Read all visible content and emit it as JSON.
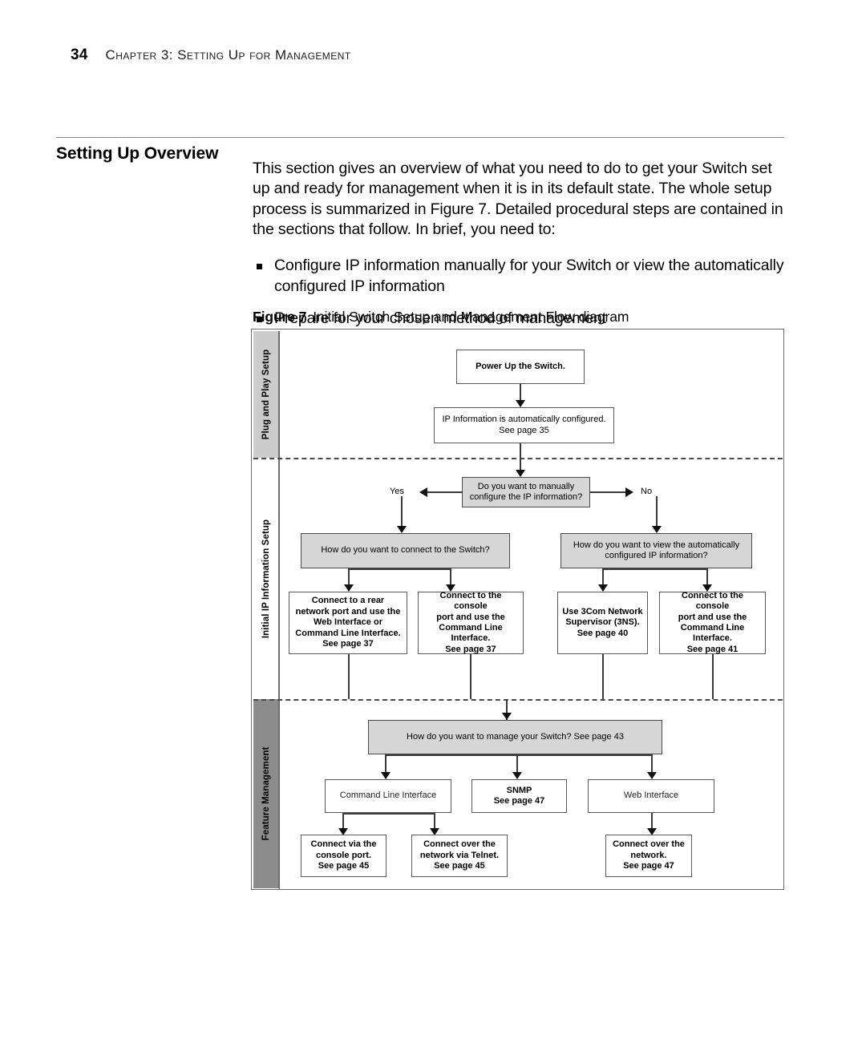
{
  "header": {
    "folio": "34",
    "chapter": "Chapter 3: Setting Up for Management"
  },
  "section": {
    "heading": "Setting Up Overview",
    "intro": "This section gives an overview of what you need to do to get your Switch set up and ready for management when it is in its default state. The whole setup process is summarized in Figure 7. Detailed procedural steps are contained in the sections that follow. In brief, you need to:",
    "bullets": [
      "Configure IP information manually for your Switch or view the automatically configured IP information",
      "Prepare for your chosen method of management"
    ]
  },
  "figure": {
    "label": "Figure 7",
    "caption": "Initial Switch Setup and Management Flow diagram",
    "bands": [
      {
        "id": "plug-and-play-setup",
        "label": "Plug and Play Setup",
        "fill": "#cccccc"
      },
      {
        "id": "initial-ip-information-setup",
        "label": "Initial IP Information Setup",
        "fill": "#ffffff"
      },
      {
        "id": "feature-management",
        "label": "Feature Management",
        "fill": "#8c8c8c"
      }
    ],
    "branch_labels": {
      "yes": "Yes",
      "no": "No"
    },
    "nodes": {
      "power_up": "Power Up the Switch.",
      "ip_auto": "IP Information is automatically configured.\nSee page 35",
      "decision": "Do you want to manually\nconfigure the IP information?",
      "how_connect": "How do you want to connect to the Switch?",
      "how_view": "How do you want to view the automatically\nconfigured IP information?",
      "rear_port": "Connect to a rear\nnetwork port and use the\nWeb Interface or\nCommand Line Interface.\nSee page 37",
      "console_cli_37": "Connect to the console\nport and use the\nCommand Line\nInterface.\nSee page 37",
      "network_supervisor": "Use 3Com Network\nSupervisor (3NS).\nSee page 40",
      "console_cli_41": "Connect to the console\nport and use the\nCommand Line\nInterface.\nSee page 41",
      "how_manage": "How do you want to manage your Switch? See page 43",
      "cli": "Command Line Interface",
      "snmp": "SNMP\nSee page 47",
      "web": "Web Interface",
      "via_console": "Connect via the\nconsole port.\nSee page 45",
      "via_telnet": "Connect over the\nnetwork via Telnet.\nSee page 45",
      "over_network": "Connect over the\nnetwork.\nSee page 47"
    }
  }
}
